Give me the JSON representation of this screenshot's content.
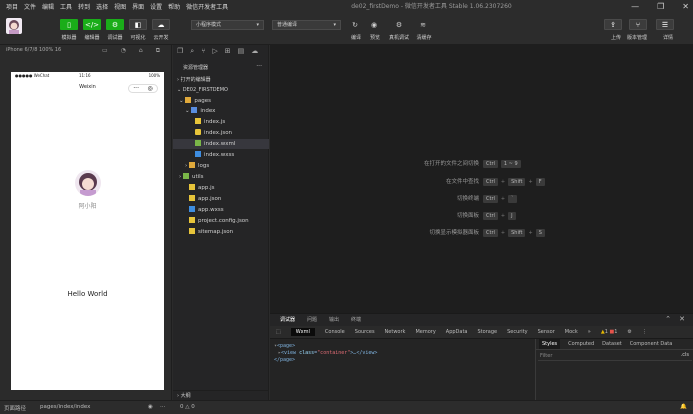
{
  "menubar": {
    "items": [
      "项目",
      "文件",
      "编辑",
      "工具",
      "转到",
      "选择",
      "视图",
      "界面",
      "设置",
      "帮助",
      "微信开发者工具"
    ],
    "title": "de02_firstDemo - 微信开发者工具 Stable 1.06.2307260"
  },
  "toolbar": {
    "buttons": [
      {
        "label": "模拟器",
        "icon": "phone-icon"
      },
      {
        "label": "编辑器",
        "icon": "code-icon"
      },
      {
        "label": "调试器",
        "icon": "bug-icon"
      },
      {
        "label": "可视化",
        "icon": "eye-icon"
      },
      {
        "label": "云开发",
        "icon": "cloud-icon"
      }
    ],
    "mode_select": "小程序模式",
    "compile_select": "普通编译",
    "actions": [
      {
        "label": "编译",
        "icon": "refresh-icon"
      },
      {
        "label": "预览",
        "icon": "eye-icon"
      },
      {
        "label": "真机调试",
        "icon": "gear-icon"
      },
      {
        "label": "清缓存",
        "icon": "layers-icon"
      }
    ],
    "right": [
      {
        "label": "上传",
        "icon": "upload-icon"
      },
      {
        "label": "版本管理",
        "icon": "branch-icon"
      },
      {
        "label": "详情",
        "icon": "detail-icon"
      }
    ],
    "accent": "#1aad19"
  },
  "simulator": {
    "device": "iPhone 6/7/8 100% 16",
    "status_left": "●●●●● WeChat",
    "status_time": "11:16",
    "status_right": "100%",
    "nav_title": "Weixin",
    "username": "阿小阳",
    "hello": "Hello World"
  },
  "explorer": {
    "title": "资源管理器",
    "open_editors": "打开的编辑器",
    "project": "DE02_FIRSTDEMO",
    "tree": [
      {
        "name": "pages",
        "type": "folder",
        "depth": 1
      },
      {
        "name": "index",
        "type": "folder",
        "depth": 2
      },
      {
        "name": "index.js",
        "type": "js",
        "depth": 3
      },
      {
        "name": "index.json",
        "type": "json",
        "depth": 3
      },
      {
        "name": "index.wxml",
        "type": "wxml",
        "depth": 3
      },
      {
        "name": "index.wxss",
        "type": "wxss",
        "depth": 3
      },
      {
        "name": "logs",
        "type": "folder",
        "depth": 2
      },
      {
        "name": "utils",
        "type": "folder",
        "depth": 1
      },
      {
        "name": "app.js",
        "type": "js",
        "depth": 1
      },
      {
        "name": "app.json",
        "type": "json",
        "depth": 1
      },
      {
        "name": "app.wxss",
        "type": "wxss",
        "depth": 1
      },
      {
        "name": "project.config.json",
        "type": "json",
        "depth": 1
      },
      {
        "name": "sitemap.json",
        "type": "json",
        "depth": 1
      }
    ],
    "outline": "大纲"
  },
  "welcome": {
    "rows": [
      {
        "label": "在打开的文件之间切换",
        "keys": [
          "Ctrl",
          "1 ~ 9"
        ]
      },
      {
        "label": "在文件中查找",
        "keys": [
          "Ctrl",
          "Shift",
          "F"
        ]
      },
      {
        "label": "切换终端",
        "keys": [
          "Ctrl",
          "`"
        ]
      },
      {
        "label": "切换面板",
        "keys": [
          "Ctrl",
          "J"
        ]
      },
      {
        "label": "切换显示模拟器面板",
        "keys": [
          "Ctrl",
          "Shift",
          "S"
        ]
      }
    ]
  },
  "debugger": {
    "top_tabs": [
      "调试器",
      "问题",
      "输出",
      "终端"
    ],
    "tabs": [
      "Wxml",
      "Console",
      "Sources",
      "Network",
      "Memory",
      "AppData",
      "Storage",
      "Security",
      "Sensor",
      "Mock"
    ],
    "warn_count": "1",
    "err_count": "1",
    "code": {
      "line1": "<page>",
      "line2_tag_open": "<view",
      "line2_attr": "class",
      "line2_val": "\"container\"",
      "line2_close": ">…</view>",
      "line3": "</page>"
    },
    "right_tabs": [
      "Styles",
      "Computed",
      "Dataset",
      "Component Data"
    ],
    "filter_placeholder": "Filter",
    "cls": ".cls"
  },
  "statusbar": {
    "left": "页面路径",
    "path": "pages/index/index",
    "right": "0 △ 0"
  }
}
